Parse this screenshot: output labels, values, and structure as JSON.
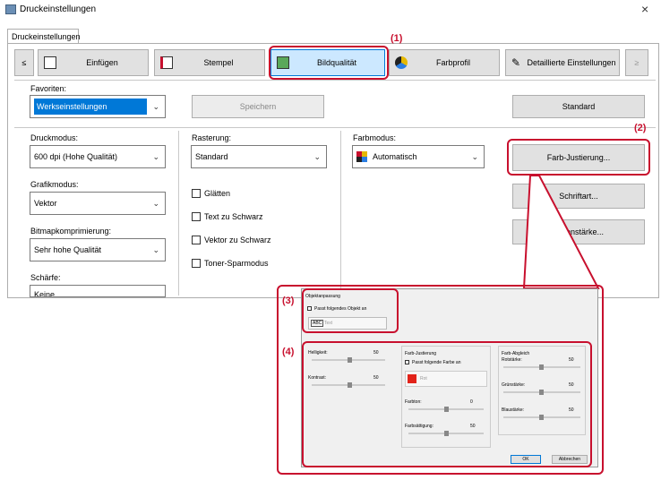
{
  "window": {
    "title": "Druckeinstellungen",
    "close": "×"
  },
  "tab": "Druckeinstellungen",
  "toolbar": {
    "prev": "≤",
    "next": "≥",
    "einfuegen": "Einfügen",
    "stempel": "Stempel",
    "bildqualitaet": "Bildqualität",
    "farbprofil": "Farbprofil",
    "detail": "Detaillierte Einstellungen"
  },
  "favoriten": {
    "label": "Favoriten:",
    "value": "Werkseinstellungen",
    "save": "Speichern",
    "standard": "Standard"
  },
  "druckmodus": {
    "label": "Druckmodus:",
    "value": "600 dpi (Hohe Qualität)"
  },
  "rasterung": {
    "label": "Rasterung:",
    "value": "Standard"
  },
  "farbmodus": {
    "label": "Farbmodus:",
    "value": "Automatisch"
  },
  "grafikmodus": {
    "label": "Grafikmodus:",
    "value": "Vektor"
  },
  "bitmap": {
    "label": "Bitmapkomprimierung:",
    "value": "Sehr hohe Qualität"
  },
  "schaerfe": {
    "label": "Schärfe:",
    "value": "Keine"
  },
  "checks": {
    "glaetten": "Glätten",
    "text": "Text zu Schwarz",
    "vektor": "Vektor zu Schwarz",
    "toner": "Toner-Sparmodus"
  },
  "rightbtns": {
    "farb": "Farb-Justierung...",
    "schrift": "Schriftart...",
    "linie": "Linienstärke..."
  },
  "callouts": {
    "c1": "(1)",
    "c2": "(2)",
    "c3": "(3)",
    "c4": "(4)"
  },
  "dialog": {
    "objekt": {
      "title": "Objektanpassung",
      "check": "Passt folgendes Objekt an",
      "icon": "ABC",
      "value": "Text"
    },
    "helligkeit": {
      "label": "Helligkeit:",
      "value": "50"
    },
    "kontrast": {
      "label": "Kontrast:",
      "value": "50"
    },
    "farbjust": {
      "title": "Farb-Justierung",
      "check": "Passt folgende Farbe an",
      "value": "Rot"
    },
    "farbton": {
      "label": "Farbton:",
      "value": "0"
    },
    "farbsaett": {
      "label": "Farbsättigung:",
      "value": "50"
    },
    "abgleich": {
      "title": "Farb-Abgleich"
    },
    "rot": {
      "label": "Rotstärke:",
      "value": "50"
    },
    "gruen": {
      "label": "Grünstärke:",
      "value": "50"
    },
    "blau": {
      "label": "Blaustärke:",
      "value": "50"
    },
    "ok": "OK",
    "cancel": "Abbrechen"
  },
  "colors": {
    "accent": "#0078d7",
    "callout": "#c8102e",
    "selected_bg": "#cce8ff"
  }
}
